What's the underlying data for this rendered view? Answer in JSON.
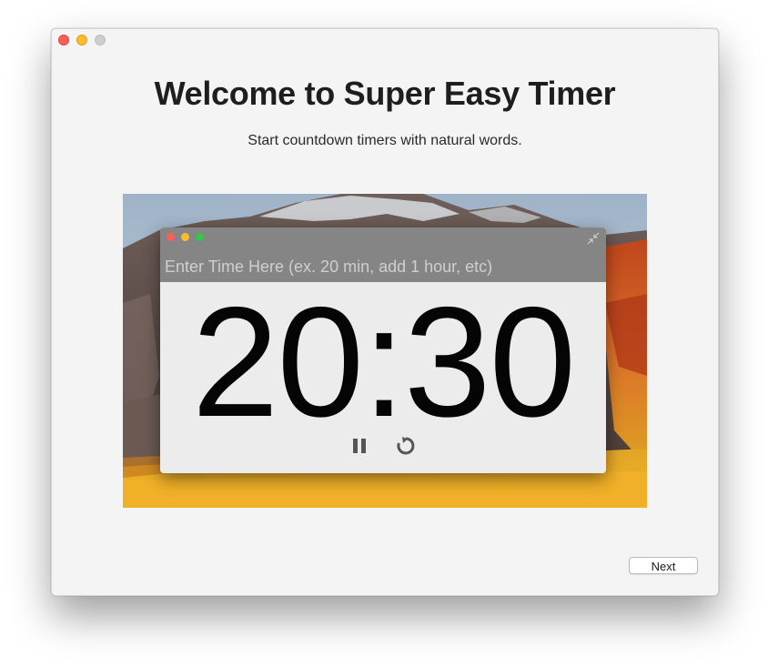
{
  "window": {
    "title": "Welcome to Super Easy Timer",
    "subtitle": "Start countdown timers with natural words."
  },
  "preview": {
    "input_placeholder": "Enter Time Here (ex. 20 min, add 1 hour, etc)",
    "time": "20:30",
    "controls": {
      "pause_icon": "pause-icon",
      "reset_icon": "reset-icon"
    }
  },
  "footer": {
    "next_label": "Next"
  },
  "colors": {
    "close": "#fc5f57",
    "minimize": "#fdbc2e",
    "zoom_inactive": "#cdcdcd",
    "zoom": "#33c748",
    "mini_titlebar": "#858585",
    "window_bg": "#f4f4f4"
  }
}
